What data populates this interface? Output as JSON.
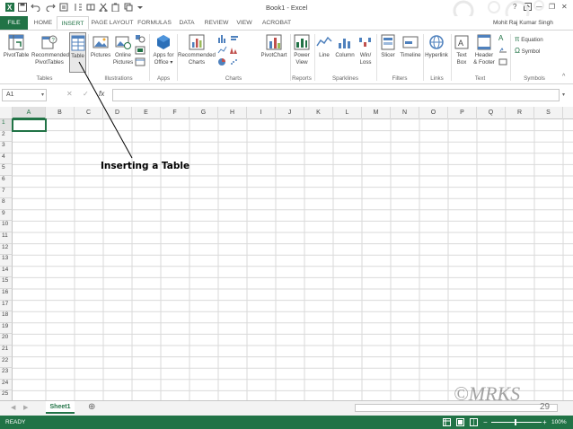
{
  "window": {
    "title": "Book1 - Excel",
    "user": "Mohit Raj Kumar Singh",
    "help": "?",
    "minimize": "—",
    "restore": "❐",
    "close": "✕"
  },
  "tabs": [
    "FILE",
    "HOME",
    "INSERT",
    "PAGE LAYOUT",
    "FORMULAS",
    "DATA",
    "REVIEW",
    "VIEW",
    "ACROBAT"
  ],
  "ribbon": {
    "groups": {
      "tables": "Tables",
      "illustrations": "Illustrations",
      "apps": "Apps",
      "charts": "Charts",
      "reports": "Reports",
      "sparklines": "Sparklines",
      "filters": "Filters",
      "links": "Links",
      "text": "Text",
      "symbols": "Symbols"
    },
    "buttons": {
      "pivottable": "PivotTable",
      "recommended_pivottables_1": "Recommended",
      "recommended_pivottables_2": "PivotTables",
      "table": "Table",
      "pictures": "Pictures",
      "online_pictures_1": "Online",
      "online_pictures_2": "Pictures",
      "apps_for_office_1": "Apps for",
      "apps_for_office_2": "Office ▾",
      "recommended_charts_1": "Recommended",
      "recommended_charts_2": "Charts",
      "pivotchart": "PivotChart",
      "power_view_1": "Power",
      "power_view_2": "View",
      "line": "Line",
      "column": "Column",
      "winloss_1": "Win/",
      "winloss_2": "Loss",
      "slicer": "Slicer",
      "timeline": "Timeline",
      "hyperlink": "Hyperlink",
      "text_box_1": "Text",
      "text_box_2": "Box",
      "header_footer_1": "Header",
      "header_footer_2": "& Footer",
      "equation": "Equation",
      "symbol": "Symbol"
    }
  },
  "formula_bar": {
    "name_box": "A1",
    "fx": "fx",
    "value": ""
  },
  "grid": {
    "columns": [
      "A",
      "B",
      "C",
      "D",
      "E",
      "F",
      "G",
      "H",
      "I",
      "J",
      "K",
      "L",
      "M",
      "N",
      "O",
      "P",
      "Q",
      "R",
      "S"
    ],
    "rows": [
      "1",
      "2",
      "3",
      "4",
      "5",
      "6",
      "7",
      "8",
      "9",
      "10",
      "11",
      "12",
      "13",
      "14",
      "15",
      "16",
      "17",
      "18",
      "19",
      "20",
      "21",
      "22",
      "23",
      "24",
      "25"
    ],
    "selected_cell": "A1"
  },
  "annotation": {
    "text": "Inserting a Table"
  },
  "watermark": "©MRKS",
  "slide_number": "29",
  "sheets": [
    "Sheet1"
  ],
  "add_sheet": "⊕",
  "status": {
    "ready": "READY",
    "zoom": "100%"
  },
  "colors": {
    "accent": "#217346",
    "ribbon_bg": "#ffffff",
    "header_bg": "#f3f3f3"
  }
}
